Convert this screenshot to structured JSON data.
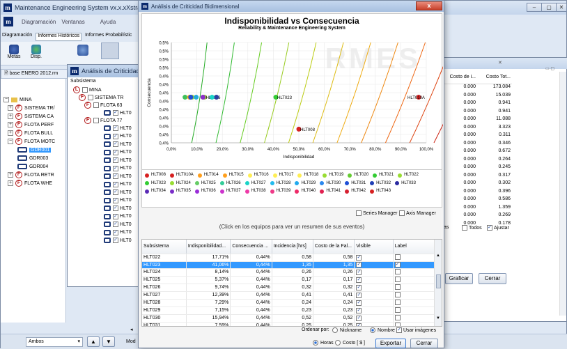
{
  "main_window": {
    "title": "Maintenance Engineering System vx.x.xXstrata",
    "menu": [
      "Diagramación",
      "Ventanas",
      "Ayuda"
    ],
    "tabs": [
      "Diagramación",
      "Informes Históricos",
      "Informes Probabilístic"
    ],
    "toolbar": [
      "Metas",
      "Disp."
    ],
    "file_tab": "base ENERO 2012.rm",
    "bottom_select": "Ambos",
    "bottom_label": "Mod"
  },
  "crit_small": {
    "title": "Análisis de Criticidad",
    "col_header": "Subsistema"
  },
  "tree": {
    "root": "MINA",
    "items": [
      "SISTEMA TR/",
      "SISTEMA CA",
      "FLOTA PERF",
      "FLOTA BULL",
      "FLOTA MOTC",
      "GDR001",
      "GDR003",
      "GDR004",
      "FLOTA RETR",
      "FLOTA WHE"
    ]
  },
  "inner_tree": {
    "root": "MINA",
    "items": [
      "SISTEMA TR",
      "FLOTA 63",
      "HLT0",
      "FLOTA 77",
      "HLT0",
      "HLT0",
      "HLT0",
      "HLT0",
      "HLT0",
      "HLT0",
      "HLT0",
      "HLT0",
      "HLT0",
      "HLT0",
      "HLT0",
      "HLT0",
      "HLT0",
      "HLT0",
      "HLT0"
    ]
  },
  "right_panel": {
    "headers": [
      "Costo de i...",
      "Costo Tot..."
    ],
    "rows": [
      [
        "0.000",
        "173.084"
      ],
      [
        "0.000",
        "15.039"
      ],
      [
        "0.000",
        "0.941"
      ],
      [
        "0.000",
        "0.941"
      ],
      [
        "0.000",
        "11.088"
      ],
      [
        "0.000",
        "3.323"
      ],
      [
        "0.000",
        "0.311"
      ],
      [
        "0.000",
        "0.346"
      ],
      [
        "0.000",
        "0.672"
      ],
      [
        "0.000",
        "0.264"
      ],
      [
        "0.000",
        "0.245"
      ],
      [
        "0.000",
        "0.317"
      ],
      [
        "0.000",
        "0.302"
      ],
      [
        "0.000",
        "0.396"
      ],
      [
        "0.000",
        "0.586"
      ],
      [
        "0.000",
        "1.359"
      ],
      [
        "0.000",
        "0.269"
      ],
      [
        "0.000",
        "0.178"
      ]
    ],
    "todos": "Todos",
    "ajustar": "Ajustar",
    "tas": "tas",
    "graficar": "Graficar",
    "cerrar": "Cerrar"
  },
  "dialog": {
    "title": "Análisis de Criticidad Bidimensional",
    "close": "x",
    "chart_title": "Indisponibilidad vs Consecuencia",
    "chart_subtitle": "Reliability & Maintenance Engineering System",
    "watermark": "RMES",
    "series_manager": "Series Manager",
    "axis_manager": "Axis Manager",
    "click_hint": "(Click en los equipos para ver un resumen de sus eventos)",
    "table_headers": [
      "Subsistema",
      "Indisponibilidad...",
      "Consecuencia ...",
      "Incidencia [hrs]",
      "Costo de la Fal...",
      "Visible",
      "Label"
    ],
    "rows": [
      {
        "name": "HLT022",
        "ind": "17,71%",
        "con": "0,44%",
        "inc": "0,58",
        "cost": "0,58",
        "visible": true,
        "label": false
      },
      {
        "name": "HLT023",
        "ind": "41,06%",
        "con": "0,44%",
        "inc": "1,35",
        "cost": "1,35",
        "visible": true,
        "label": true
      },
      {
        "name": "HLT024",
        "ind": "8,14%",
        "con": "0,44%",
        "inc": "0,26",
        "cost": "0,26",
        "visible": true,
        "label": false
      },
      {
        "name": "HLT025",
        "ind": "5,37%",
        "con": "0,44%",
        "inc": "0,17",
        "cost": "0,17",
        "visible": true,
        "label": false
      },
      {
        "name": "HLT026",
        "ind": "9,74%",
        "con": "0,44%",
        "inc": "0,32",
        "cost": "0,32",
        "visible": true,
        "label": false
      },
      {
        "name": "HLT027",
        "ind": "12,39%",
        "con": "0,44%",
        "inc": "0,41",
        "cost": "0,41",
        "visible": true,
        "label": false
      },
      {
        "name": "HLT028",
        "ind": "7,29%",
        "con": "0,44%",
        "inc": "0,24",
        "cost": "0,24",
        "visible": true,
        "label": false
      },
      {
        "name": "HLT029",
        "ind": "7,15%",
        "con": "0,44%",
        "inc": "0,23",
        "cost": "0,23",
        "visible": true,
        "label": false
      },
      {
        "name": "HLT030",
        "ind": "15,94%",
        "con": "0,44%",
        "inc": "0,52",
        "cost": "0,52",
        "visible": true,
        "label": false
      },
      {
        "name": "HLT031",
        "ind": "7,59%",
        "con": "0,44%",
        "inc": "0,25",
        "cost": "0,25",
        "visible": true,
        "label": false
      }
    ],
    "order_by": "Ordenar por:",
    "opt_nickname": "Nickname",
    "opt_nombre": "Nombre",
    "opt_imagenes": "Usar imágenes",
    "opt_horas": "Horas",
    "opt_costo": "Costo [ $ ]",
    "export": "Exportar",
    "close_btn": "Cerrar"
  },
  "chart_data": {
    "type": "scatter",
    "title": "Indisponibilidad vs Consecuencia",
    "subtitle": "Reliability & Maintenance Engineering System",
    "xlabel": "Indisponibilidad",
    "ylabel": "Consecuencia",
    "x_ticks": [
      "0,0%",
      "10,0%",
      "20,0%",
      "30,0%",
      "40,0%",
      "50,0%",
      "60,0%",
      "70,0%",
      "80,0%",
      "90,0%",
      "100,0%"
    ],
    "y_ticks": [
      "0,5%",
      "0,5%",
      "0,5%",
      "0,5%",
      "0,4%",
      "0,4%",
      "0,4%",
      "0,4%",
      "0,4%",
      "0,4%",
      "0,4%",
      "0,4%",
      "0,4%"
    ],
    "xlim": [
      0,
      100
    ],
    "ylim_ticks_count": 13,
    "points": [
      {
        "name": "HLT008",
        "x": 50,
        "y": 0.405,
        "color": "#d62020",
        "label": true
      },
      {
        "name": "HLT010A",
        "x": 97,
        "y": 0.44,
        "color": "#d62020",
        "label": true
      },
      {
        "name": "HLT016",
        "x": 13,
        "y": 0.44,
        "color": "#99cc33",
        "label": true
      },
      {
        "name": "HLT023",
        "x": 41,
        "y": 0.44,
        "color": "#33cc33",
        "label": true
      },
      {
        "name": "HLT022",
        "x": 17.71,
        "y": 0.44,
        "color": "#2a3fa0",
        "label": false
      },
      {
        "name": "HLT024",
        "x": 8.14,
        "y": 0.44,
        "color": "#9acd32",
        "label": false
      },
      {
        "name": "HLT025",
        "x": 5.37,
        "y": 0.44,
        "color": "#3fc05a",
        "label": false
      },
      {
        "name": "HLT026",
        "x": 9.74,
        "y": 0.44,
        "color": "#22aadd",
        "label": false
      },
      {
        "name": "HLT027",
        "x": 12.39,
        "y": 0.44,
        "color": "#8b2dc8",
        "label": false
      },
      {
        "name": "HLT028",
        "x": 7.29,
        "y": 0.44,
        "color": "#ee3aa8",
        "label": false
      },
      {
        "name": "HLT029",
        "x": 7.15,
        "y": 0.44,
        "color": "#ffa81e",
        "label": false
      },
      {
        "name": "HLT030",
        "x": 15.94,
        "y": 0.44,
        "color": "#1bd4c7",
        "label": false
      },
      {
        "name": "HLT031",
        "x": 7.59,
        "y": 0.44,
        "color": "#1f4fd6",
        "label": false
      }
    ],
    "iso_curve_colors": [
      "#22aa22",
      "#33bb33",
      "#66cc22",
      "#99cc22",
      "#bbcc11",
      "#ddbb11",
      "#eeaa11",
      "#ee8811",
      "#ee6611",
      "#dd4411",
      "#cc2211"
    ],
    "legend": [
      {
        "name": "HLT008",
        "color": "#d62020"
      },
      {
        "name": "HLT010A",
        "color": "#d62020"
      },
      {
        "name": "HLT014",
        "color": "#ff9f1c"
      },
      {
        "name": "HLT015",
        "color": "#ff9f1c"
      },
      {
        "name": "HLT016",
        "color": "#ffee55"
      },
      {
        "name": "HLT017",
        "color": "#ffee55"
      },
      {
        "name": "HLT018",
        "color": "#ffee55"
      },
      {
        "name": "HLT019",
        "color": "#99dd33"
      },
      {
        "name": "HLT020",
        "color": "#66cc33"
      },
      {
        "name": "HLT021",
        "color": "#33cc33"
      },
      {
        "name": "HLT022",
        "color": "#99dd33"
      },
      {
        "name": "HLT023",
        "color": "#33cc33"
      },
      {
        "name": "HLT024",
        "color": "#99dd33"
      },
      {
        "name": "HLT025",
        "color": "#66cc66"
      },
      {
        "name": "HLT026",
        "color": "#33cc99"
      },
      {
        "name": "HLT027",
        "color": "#1bd4c7"
      },
      {
        "name": "HLT028",
        "color": "#22bbee"
      },
      {
        "name": "HLT029",
        "color": "#22aaee"
      },
      {
        "name": "HLT030",
        "color": "#2a88ee"
      },
      {
        "name": "HLT031",
        "color": "#1f4fd6"
      },
      {
        "name": "HLT032",
        "color": "#1f3fb6"
      },
      {
        "name": "HLT033",
        "color": "#2a2aa0"
      },
      {
        "name": "HLT034",
        "color": "#5a2ab6"
      },
      {
        "name": "HLT035",
        "color": "#7a2dc8"
      },
      {
        "name": "HLT036",
        "color": "#9a2dd8"
      },
      {
        "name": "HLT037",
        "color": "#cc33cc"
      },
      {
        "name": "HLT038",
        "color": "#ee3aa8"
      },
      {
        "name": "HLT039",
        "color": "#ee3a88"
      },
      {
        "name": "HLT040",
        "color": "#ee2a68"
      },
      {
        "name": "HLT041",
        "color": "#e02050"
      },
      {
        "name": "HLT042",
        "color": "#d62030"
      },
      {
        "name": "HLT043",
        "color": "#d62020"
      }
    ]
  }
}
